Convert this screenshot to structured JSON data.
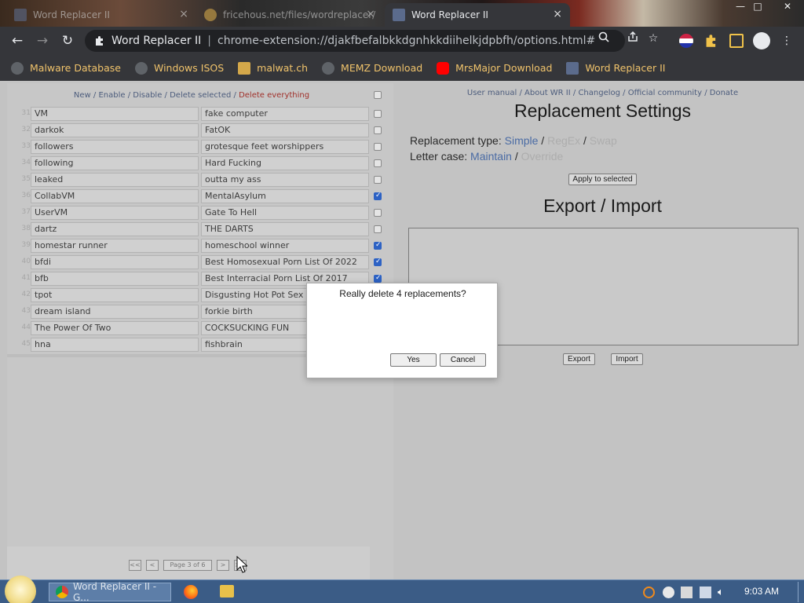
{
  "browser": {
    "tabs": [
      {
        "title": "Word Replacer II",
        "close": "×"
      },
      {
        "title": "fricehous.net/files/wordreplacer/",
        "close": "×"
      },
      {
        "title": "Word Replacer II",
        "close": "×"
      }
    ],
    "window_controls": {
      "minimize": "—",
      "maximize": "□",
      "close": "✕"
    },
    "nav": {
      "back": "←",
      "forward": "→",
      "reload": "↻"
    },
    "omnibox": {
      "site": "Word Replacer II",
      "url": "chrome-extension://djakfbefalbkkdgnhkkdiihelkjdpbfh/options.html#"
    },
    "bookmarks": [
      {
        "label": "Malware Database",
        "icon": "globe-icon"
      },
      {
        "label": "Windows ISOS",
        "icon": "globe-icon"
      },
      {
        "label": "malwat.ch",
        "icon": "malwatch-icon"
      },
      {
        "label": "MEMZ Download",
        "icon": "globe-icon"
      },
      {
        "label": "MrsMajor Download",
        "icon": "youtube-icon"
      },
      {
        "label": "Word Replacer II",
        "icon": "word-replacer-icon"
      }
    ]
  },
  "left_panel": {
    "toolbar": {
      "new": "New",
      "sep1": " / ",
      "enable": "Enable",
      "sep2": " / ",
      "disable": "Disable",
      "sep3": " / ",
      "delete_selected": "Delete selected",
      "sep4": " / ",
      "delete_everything": "Delete everything"
    },
    "rows": [
      {
        "num": "31",
        "from": "VM",
        "to": "fake computer",
        "checked": false
      },
      {
        "num": "32",
        "from": "darkok",
        "to": "FatOK",
        "checked": false
      },
      {
        "num": "33",
        "from": "followers",
        "to": "grotesque feet worshippers",
        "checked": false
      },
      {
        "num": "34",
        "from": "following",
        "to": "Hard Fucking",
        "checked": false
      },
      {
        "num": "35",
        "from": "leaked",
        "to": "outta my ass",
        "checked": false
      },
      {
        "num": "36",
        "from": "CollabVM",
        "to": "MentalAsylum",
        "checked": true
      },
      {
        "num": "37",
        "from": "UserVM",
        "to": "Gate To Hell",
        "checked": false
      },
      {
        "num": "38",
        "from": "dartz",
        "to": "THE DARTS",
        "checked": false
      },
      {
        "num": "39",
        "from": "homestar runner",
        "to": "homeschool winner",
        "checked": true
      },
      {
        "num": "40",
        "from": "bfdi",
        "to": "Best Homosexual Porn List Of 2022",
        "checked": true
      },
      {
        "num": "41",
        "from": "bfb",
        "to": "Best Interracial Porn List Of 2017",
        "checked": true
      },
      {
        "num": "42",
        "from": "tpot",
        "to": "Disgusting Hot Pot Sex",
        "checked": false
      },
      {
        "num": "43",
        "from": "dream island",
        "to": "forkie birth",
        "checked": false
      },
      {
        "num": "44",
        "from": "The Power Of Two",
        "to": "COCKSUCKING FUN",
        "checked": false
      },
      {
        "num": "45",
        "from": "hna",
        "to": "fishbrain",
        "checked": false
      }
    ],
    "pager": {
      "first": "<<",
      "prev": "<",
      "page_label": "Page 3 of 6",
      "next": ">",
      "last": ">>"
    }
  },
  "right_panel": {
    "links": {
      "manual": "User manual",
      "sep1": " / ",
      "about": "About WR II",
      "sep2": " / ",
      "changelog": "Changelog",
      "sep3": " / ",
      "community": "Official community",
      "sep4": " / ",
      "donate": "Donate"
    },
    "settings_title": "Replacement Settings",
    "replacement_type": {
      "label": "Replacement type: ",
      "simple": "Simple",
      "sep1": " / ",
      "regex": "RegEx",
      "sep2": " / ",
      "swap": "Swap"
    },
    "letter_case": {
      "label": "Letter case: ",
      "maintain": "Maintain",
      "sep": " / ",
      "override": "Override"
    },
    "apply_button": "Apply to selected",
    "export_title": "Export / Import",
    "export_button": "Export",
    "import_button": "Import"
  },
  "dialog": {
    "message": "Really delete 4 replacements?",
    "yes": "Yes",
    "cancel": "Cancel"
  },
  "taskbar": {
    "task": "Word Replacer II - G...",
    "clock": "9:03 AM"
  },
  "colors": {
    "link": "#4c5c7c",
    "danger_link": "#a0302a",
    "checkbox_on": "#2d62c4",
    "taskbar": "#3b5c86",
    "bookmark_text": "#f0c36b"
  }
}
